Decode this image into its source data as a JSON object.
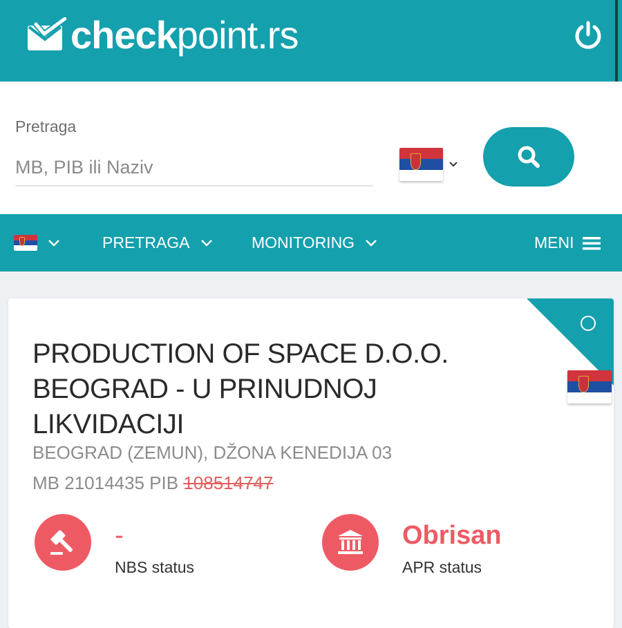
{
  "header": {
    "logo_bold": "check",
    "logo_light": "point.rs",
    "power_icon": "power-icon",
    "brand_color": "#14a0ad"
  },
  "search": {
    "label": "Pretraga",
    "placeholder": "MB, PIB ili Naziv",
    "value": "",
    "country_flag": "serbia-flag",
    "button_icon": "search-icon"
  },
  "nav": {
    "flag": "serbia-flag",
    "items": [
      {
        "label": "PRETRAGA"
      },
      {
        "label": "MONITORING"
      }
    ],
    "menu_label": "MENI"
  },
  "company": {
    "name_lines": [
      "PRODUCTION OF SPACE D.O.O.",
      "BEOGRAD - U PRINUDNOJ",
      "LIKVIDACIJI"
    ],
    "address": "BEOGRAD (ZEMUN), DŽONA KENEDIJA 03",
    "mb_label": "MB",
    "mb": "21014435",
    "pib_label": "PIB",
    "pib": "108514747",
    "country_flag": "serbia-flag",
    "statuses": [
      {
        "value": "-",
        "label": "NBS status",
        "icon": "gavel-icon"
      },
      {
        "value": "Obrisan",
        "label": "APR status",
        "icon": "bank-building-icon"
      }
    ],
    "status_color": "#ee5a64"
  }
}
